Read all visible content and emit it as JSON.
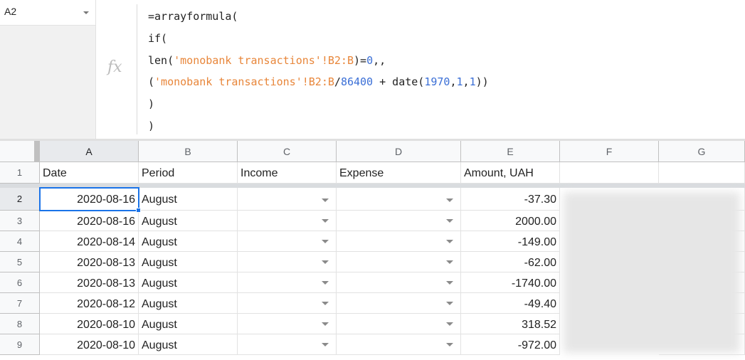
{
  "namebox": {
    "value": "A2"
  },
  "formula": {
    "line1": "=arrayformula(",
    "line2": "if(",
    "line3_pre": "len(",
    "line3_ref": "'monobank transactions'!B2:B",
    "line3_post": ")=",
    "line3_num": "0",
    "line3_end": ",,",
    "line4_open": "(",
    "line4_ref": "'monobank transactions'!B2:B",
    "line4_div": "/",
    "line4_num": "86400",
    "line4_mid": " + date(",
    "line4_y": "1970",
    "line4_c1": ",",
    "line4_m": "1",
    "line4_c2": ",",
    "line4_d": "1",
    "line4_end": "))",
    "line5": ")",
    "line6": ")"
  },
  "fx_icon": "fx-icon",
  "columns": [
    "A",
    "B",
    "C",
    "D",
    "E",
    "F",
    "G"
  ],
  "headers": [
    "Date",
    "Period",
    "Income",
    "Expense",
    "Amount, UAH",
    "",
    ""
  ],
  "row_numbers": [
    "1",
    "2",
    "3",
    "4",
    "5",
    "6",
    "7",
    "8",
    "9"
  ],
  "rows": [
    {
      "date": "2020-08-16",
      "period": "August",
      "amount": "-37.30"
    },
    {
      "date": "2020-08-16",
      "period": "August",
      "amount": "2000.00"
    },
    {
      "date": "2020-08-14",
      "period": "August",
      "amount": "-149.00"
    },
    {
      "date": "2020-08-13",
      "period": "August",
      "amount": "-62.00"
    },
    {
      "date": "2020-08-13",
      "period": "August",
      "amount": "-1740.00"
    },
    {
      "date": "2020-08-12",
      "period": "August",
      "amount": "-49.40"
    },
    {
      "date": "2020-08-10",
      "period": "August",
      "amount": "318.52"
    },
    {
      "date": "2020-08-10",
      "period": "August",
      "amount": "-972.00"
    }
  ],
  "colors": {
    "selection": "#1a73e8",
    "string": "#e8863a",
    "number": "#3b6fd6"
  }
}
